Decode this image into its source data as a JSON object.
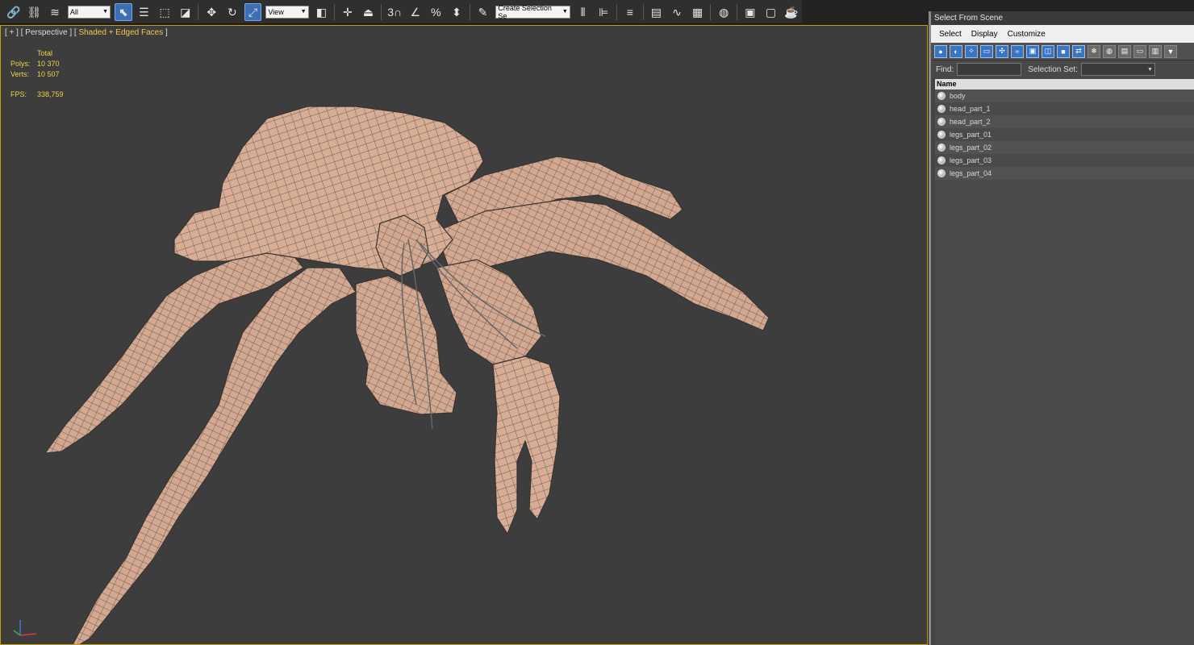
{
  "toolbar": {
    "filter_value": "All",
    "ref_coord_value": "View",
    "snap_label": "3",
    "named_selection_value": "Create Selection Se",
    "icons": [
      "link-icon",
      "unlink-icon",
      "bind-spacewarp-icon",
      "select-object-icon",
      "select-by-name-icon",
      "rect-region-icon",
      "window-crossing-icon",
      "move-icon",
      "rotate-icon",
      "scale-icon",
      "pivot-icon",
      "manipulate-icon",
      "snap-icon",
      "angle-snap-icon",
      "percent-snap-icon",
      "spinner-snap-icon",
      "edit-named-sel-icon",
      "mirror-icon",
      "align-icon",
      "layer-icon",
      "scene-explorer-icon",
      "curve-editor-icon",
      "schematic-icon",
      "material-editor-icon",
      "render-setup-icon",
      "rendered-frame-icon",
      "render-icon"
    ]
  },
  "viewport": {
    "label_prefix": "[ + ] [ Perspective ] [ ",
    "label_shading": "Shaded + Edged Faces",
    "label_suffix": " ]",
    "stats": {
      "total_label": "Total",
      "polys_label": "Polys:",
      "polys_value": "10 370",
      "verts_label": "Verts:",
      "verts_value": "10 507",
      "fps_label": "FPS:",
      "fps_value": "338,759"
    },
    "colors": {
      "background": "#3d3d3d",
      "border": "#c8a000",
      "mesh_fill": "#d8ad96",
      "wireframe": "#3a3a3a"
    }
  },
  "panel": {
    "title": "Select From Scene",
    "menu": [
      "Select",
      "Display",
      "Customize"
    ],
    "find_label": "Find:",
    "find_value": "",
    "selection_set_label": "Selection Set:",
    "column_header": "Name",
    "objects": [
      "body",
      "head_part_1",
      "head_part_2",
      "legs_part_01",
      "legs_part_02",
      "legs_part_03",
      "legs_part_04"
    ]
  }
}
